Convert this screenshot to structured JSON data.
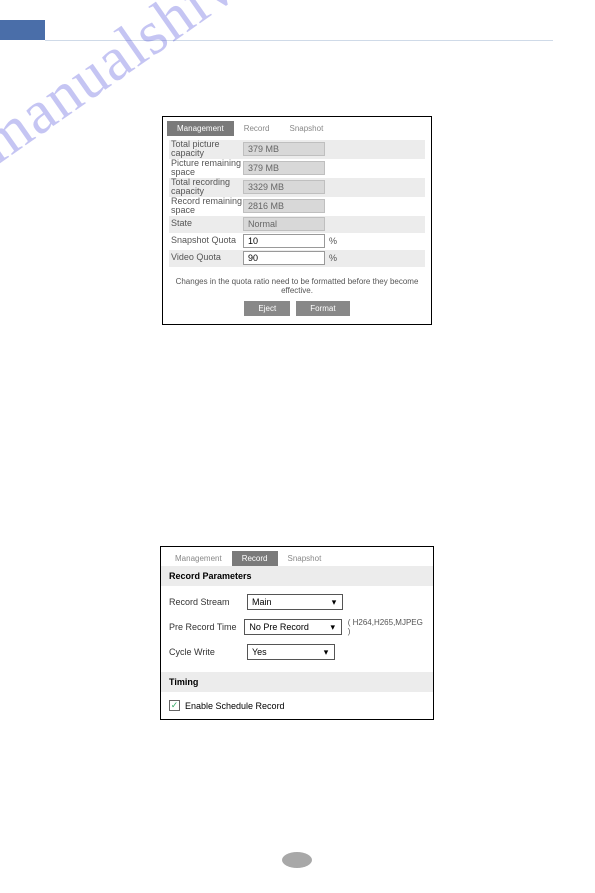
{
  "watermark": "manualshive.com",
  "panel1": {
    "tabs": {
      "management": "Management",
      "record": "Record",
      "snapshot": "Snapshot"
    },
    "rows": {
      "total_picture_capacity": {
        "label": "Total picture capacity",
        "value": "379 MB"
      },
      "picture_remaining_space": {
        "label": "Picture remaining space",
        "value": "379 MB"
      },
      "total_recording_capacity": {
        "label": "Total recording capacity",
        "value": "3329 MB"
      },
      "record_remaining_space": {
        "label": "Record remaining space",
        "value": "2816 MB"
      },
      "state": {
        "label": "State",
        "value": "Normal"
      },
      "snapshot_quota": {
        "label": "Snapshot Quota",
        "value": "10",
        "unit": "%"
      },
      "video_quota": {
        "label": "Video Quota",
        "value": "90",
        "unit": "%"
      }
    },
    "note": "Changes in the quota ratio need to be formatted before they become effective.",
    "buttons": {
      "eject": "Eject",
      "format": "Format"
    }
  },
  "panel2": {
    "tabs": {
      "management": "Management",
      "record": "Record",
      "snapshot": "Snapshot"
    },
    "section1": "Record Parameters",
    "fields": {
      "record_stream": {
        "label": "Record Stream",
        "value": "Main"
      },
      "pre_record_time": {
        "label": "Pre Record Time",
        "value": "No Pre Record",
        "hint": "( H264,H265,MJPEG )"
      },
      "cycle_write": {
        "label": "Cycle Write",
        "value": "Yes"
      }
    },
    "section2": "Timing",
    "checkbox": {
      "label": "Enable Schedule Record",
      "checked": true
    }
  }
}
